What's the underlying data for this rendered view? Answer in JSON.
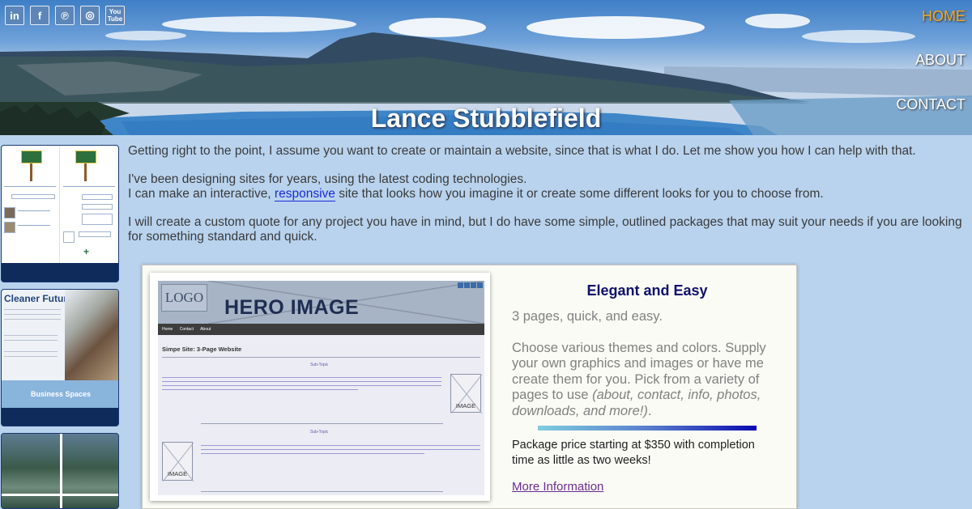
{
  "social": [
    {
      "icon": "linkedin-icon",
      "glyph": "in"
    },
    {
      "icon": "facebook-icon",
      "glyph": "f"
    },
    {
      "icon": "pinterest-icon",
      "glyph": "℗"
    },
    {
      "icon": "instagram-icon",
      "glyph": "◎"
    },
    {
      "icon": "youtube-icon",
      "glyph": "You\nTube"
    }
  ],
  "nav": {
    "home": "HOME",
    "about": "ABOUT",
    "contact": "CONTACT"
  },
  "hero": {
    "title": "Lance Stubblefield"
  },
  "sidebar": {
    "thumb2_heading": "Cleaner Future",
    "thumb2_band": "Business Spaces"
  },
  "intro": {
    "p1": "Getting right to the point, I assume you want to create or maintain a website, since that is what I do. Let me show you how I can help with that.",
    "p2_line1": "I've been designing sites for years, using the latest coding technologies.",
    "p2_line2_before": "I can make an interactive, ",
    "p2_link": "responsive",
    "p2_line2_after": " site that looks how you imagine it or create some different looks for you to choose from.",
    "p3": "I will create a custom quote for any project you have in mind, but I do have some simple, outlined packages that may suit your needs if you are looking for something standard and quick."
  },
  "mockup": {
    "logo": "LOGO",
    "hero_image": "HERO IMAGE",
    "nav": [
      "Home",
      "Contact",
      "About"
    ],
    "page_title": "Simpe Site: 3-Page Website",
    "subtopic": "Sub-Topic",
    "image_label": "IMAGE"
  },
  "package": {
    "title": "Elegant and Easy",
    "tagline": "3 pages, quick, and easy.",
    "desc_before": "Choose various themes and colors. Supply your own graphics and images or have me create them for you. Pick from a variety of pages to use ",
    "desc_italic": "(about, contact, info, photos, downloads, and more!)",
    "desc_after": ".",
    "price": "Package price starting at $350 with completion time as little as two weeks!",
    "more": "More Information"
  },
  "colors": {
    "background": "#b9d3ee",
    "nav_active": "#f4a623",
    "package_title": "#10106e",
    "link": "#1a2bd8",
    "more_link": "#6a2c91"
  }
}
